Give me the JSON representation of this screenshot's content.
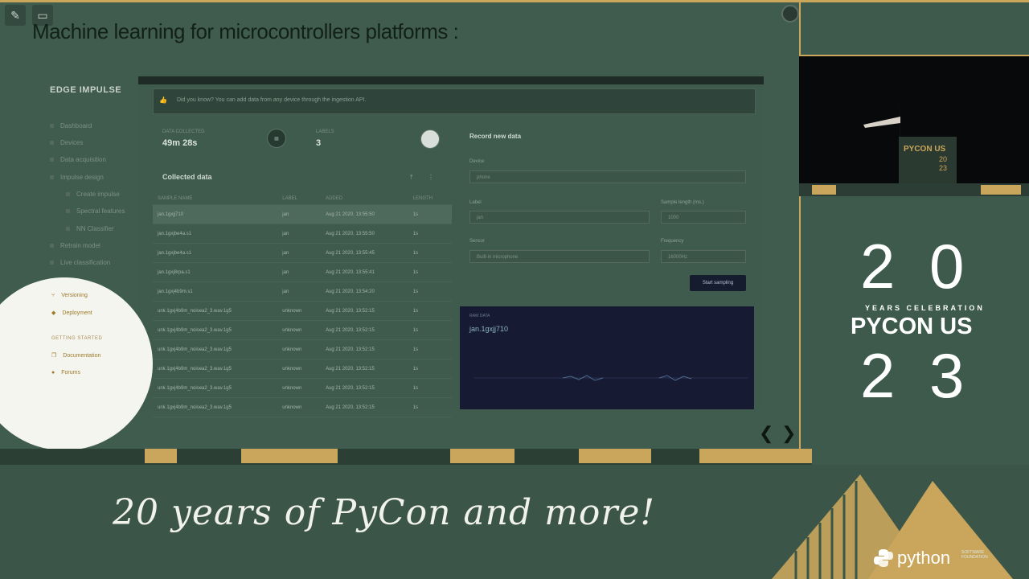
{
  "slide": {
    "title": "Machine learning for microcontrollers platforms :",
    "edit_icon": "pencil-icon",
    "video_icon": "camera-icon"
  },
  "app": {
    "logo": "EDGE IMPULSE",
    "sidebar": [
      {
        "label": "Dashboard"
      },
      {
        "label": "Devices"
      },
      {
        "label": "Data acquisition"
      },
      {
        "label": "Impulse design"
      },
      {
        "label": "Create impulse"
      },
      {
        "label": "Spectral features"
      },
      {
        "label": "NN Classifier"
      },
      {
        "label": "Retrain model"
      },
      {
        "label": "Live classification"
      }
    ],
    "tip": "Did you know? You can add data from any device through the ingestion API.",
    "stats": {
      "data_collected_label": "DATA COLLECTED",
      "data_collected_value": "49m 28s",
      "labels_label": "LABELS",
      "labels_value": "3"
    },
    "collected_data": {
      "title": "Collected data",
      "columns": [
        "SAMPLE NAME",
        "LABEL",
        "ADDED",
        "LENGTH"
      ],
      "rows": [
        [
          "jan.1gxjj710",
          "jan",
          "Aug 21 2020, 13:55:50",
          "1s"
        ],
        [
          "jan.1gxjbe4a.s1",
          "jan",
          "Aug 21 2020, 13:55:50",
          "1s"
        ],
        [
          "jan.1gxjbe4a.s1",
          "jan",
          "Aug 21 2020, 13:55:45",
          "1s"
        ],
        [
          "jan.1gxj8rpa.s1",
          "jan",
          "Aug 21 2020, 13:55:41",
          "1s"
        ],
        [
          "jan.1gxj4b9m.s1",
          "jan",
          "Aug 21 2020, 13:54:20",
          "1s"
        ],
        [
          "unk.1gxj4b9m_noisea2_3.wav.1g5",
          "unknown",
          "Aug 21 2020, 13:52:15",
          "1s"
        ],
        [
          "unk.1gxj4b9m_noisea2_3.wav.1g5",
          "unknown",
          "Aug 21 2020, 13:52:15",
          "1s"
        ],
        [
          "unk.1gxj4b9m_noisea2_3.wav.1g5",
          "unknown",
          "Aug 21 2020, 13:52:15",
          "1s"
        ],
        [
          "unk.1gxj4b9m_noisea2_3.wav.1g5",
          "unknown",
          "Aug 21 2020, 13:52:15",
          "1s"
        ],
        [
          "unk.1gxj4b9m_noisea2_3.wav.1g5",
          "unknown",
          "Aug 21 2020, 13:52:15",
          "1s"
        ],
        [
          "unk.1gxj4b9m_noisea2_3.wav.1g5",
          "unknown",
          "Aug 21 2020, 13:52:15",
          "1s"
        ]
      ]
    },
    "record": {
      "title": "Record new data",
      "device_label": "Device",
      "device_value": "phone",
      "label_label": "Label",
      "label_value": "jan",
      "sample_length_label": "Sample length (ms.)",
      "sample_length_value": "1000",
      "sensor_label": "Sensor",
      "sensor_value": "Built-in microphone",
      "frequency_label": "Frequency",
      "frequency_value": "16000Hz",
      "start_button": "Start sampling"
    },
    "preview": {
      "label": "RAW DATA",
      "sample_name": "jan.1gxjj710"
    },
    "spotlight": {
      "items": [
        {
          "label": "Versioning",
          "icon": "branch-icon"
        },
        {
          "label": "Deployment",
          "icon": "package-icon"
        }
      ],
      "heading": "GETTING STARTED",
      "links": [
        {
          "label": "Documentation",
          "icon": "book-icon"
        },
        {
          "label": "Forums",
          "icon": "chat-icon"
        }
      ]
    }
  },
  "nav": {
    "prev": "❮",
    "next": "❯"
  },
  "camera": {
    "podium_text": "PYCON US",
    "podium_year_top": "20",
    "podium_year_bottom": "23"
  },
  "event_logo": {
    "digits_top_left": "2",
    "digits_top_right": "0",
    "years_text": "YEARS CELEBRATION",
    "pycon": "PYCON US",
    "digits_bottom_left": "2",
    "digits_bottom_right": "3"
  },
  "banner": {
    "tagline": "20 years of PyCon and more!",
    "psf_name": "python",
    "psf_small": "SOFTWARE FOUNDATION"
  },
  "colors": {
    "gold": "#c9a65b",
    "dark_green": "#3a5548"
  }
}
